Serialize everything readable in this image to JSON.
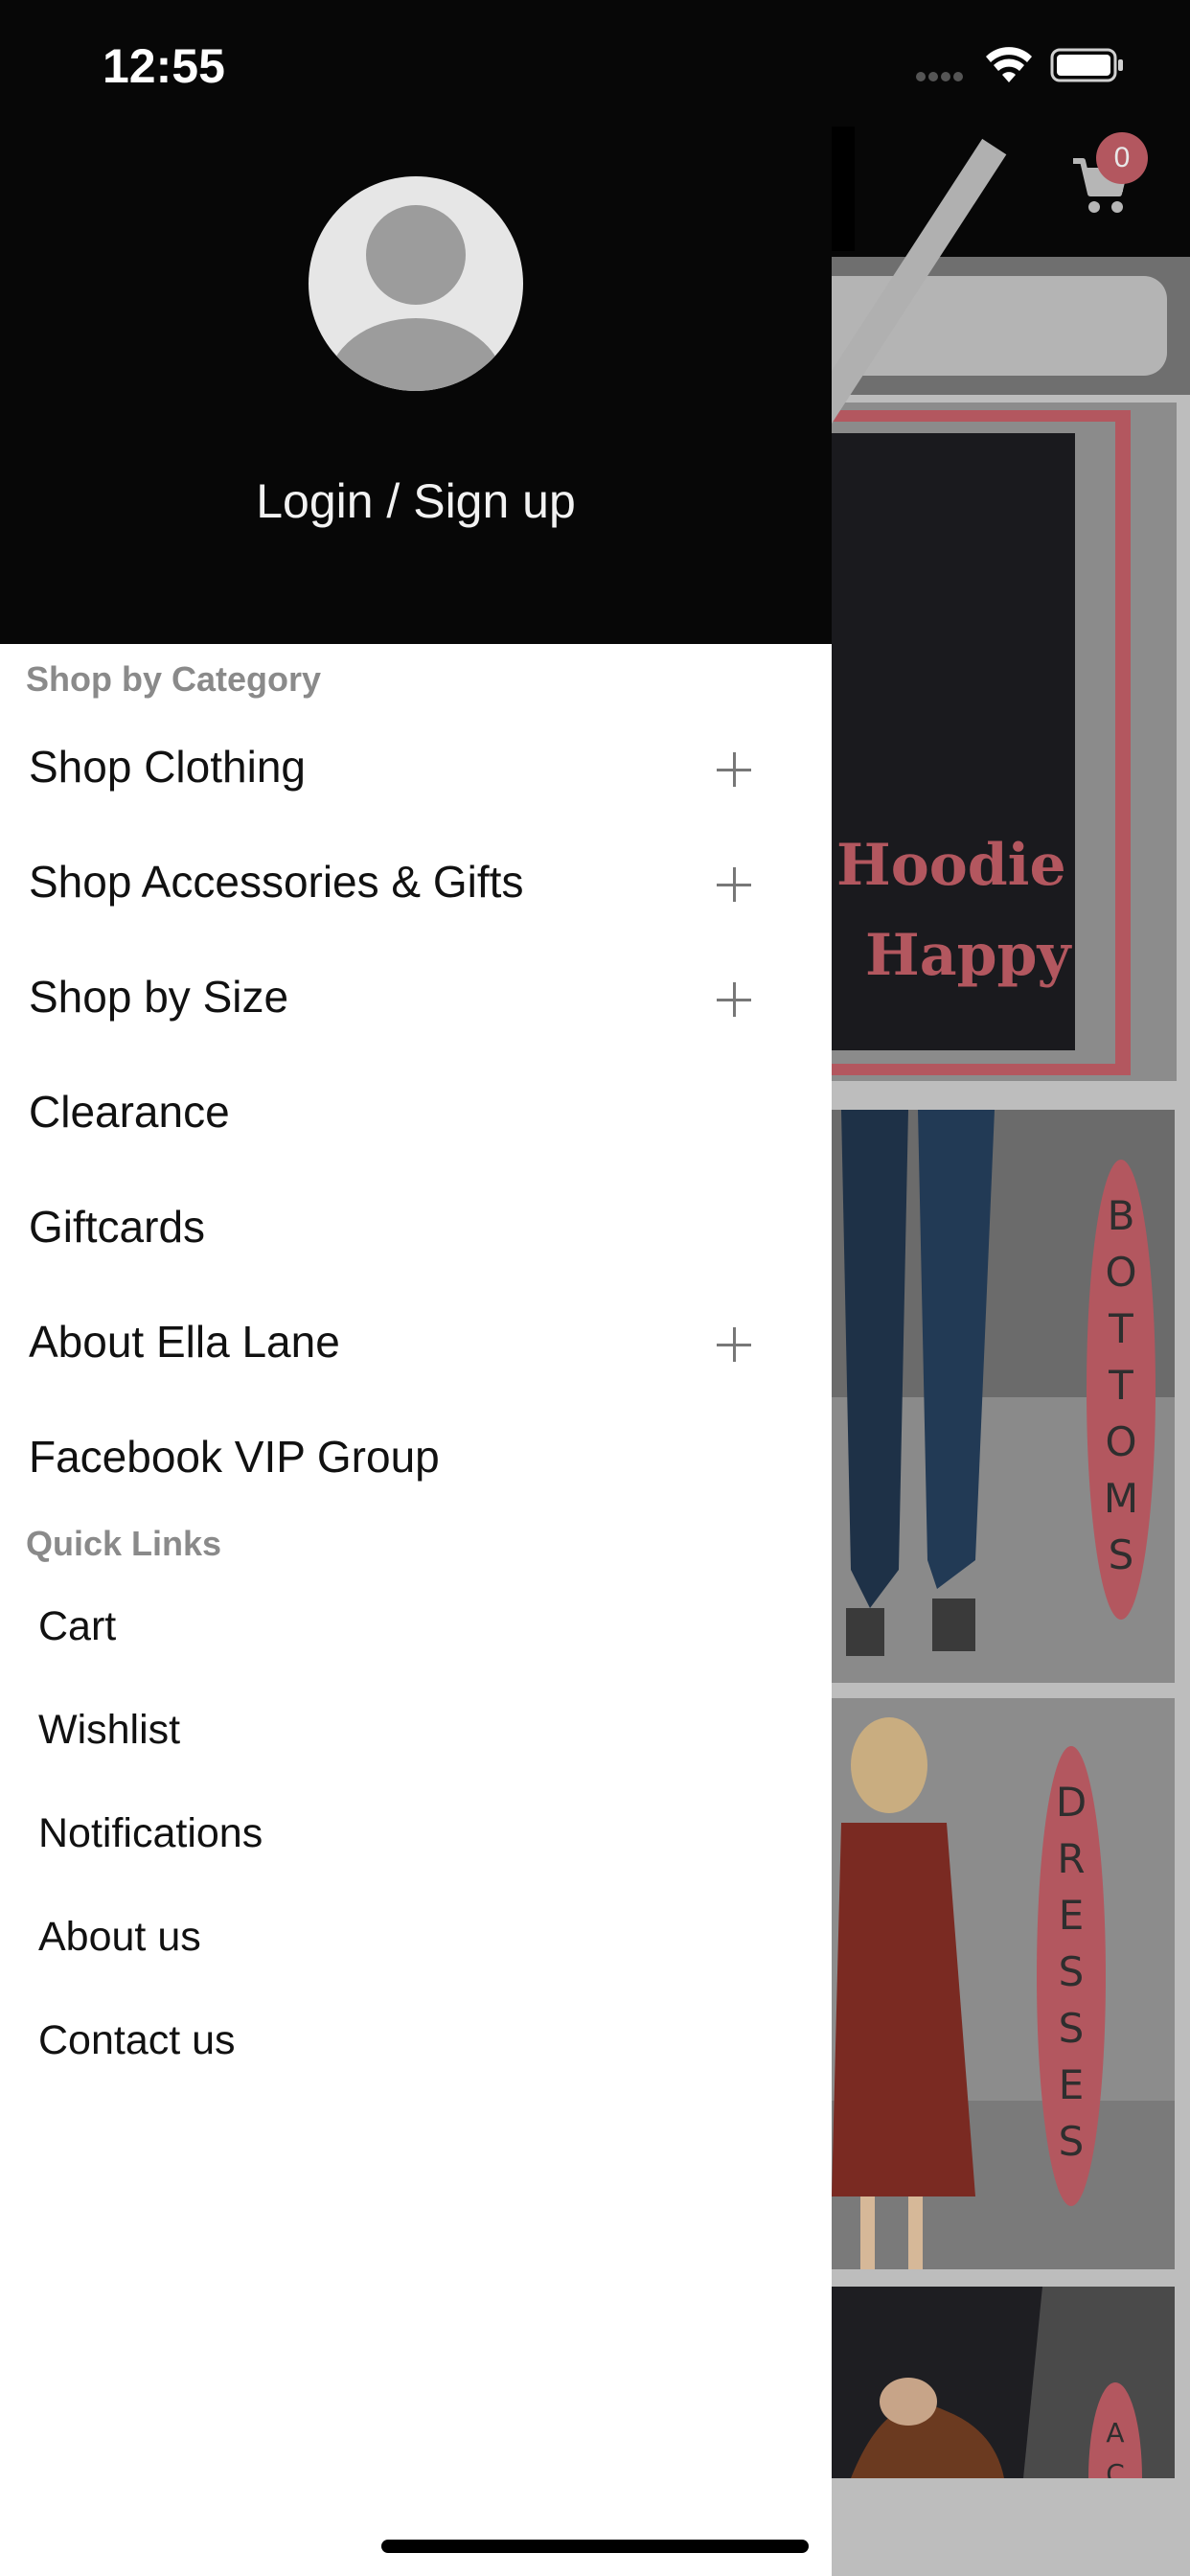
{
  "status_bar": {
    "time": "12:55"
  },
  "app": {
    "cart_count": "0",
    "banner_line_1": "Hoodie",
    "banner_line_2": "Happy",
    "tiles": {
      "bottoms": "BOTTOMS",
      "dresses": "DRESSES",
      "accessories": "ACC"
    }
  },
  "drawer": {
    "login_label": "Login / Sign up",
    "category_title": "Shop by Category",
    "categories": [
      {
        "label": "Shop Clothing",
        "expandable": true
      },
      {
        "label": "Shop Accessories & Gifts",
        "expandable": true
      },
      {
        "label": "Shop by Size",
        "expandable": true
      },
      {
        "label": "Clearance",
        "expandable": false
      },
      {
        "label": "Giftcards",
        "expandable": false
      },
      {
        "label": "About Ella Lane",
        "expandable": true
      },
      {
        "label": "Facebook VIP Group",
        "expandable": false
      }
    ],
    "quick_links_title": "Quick Links",
    "quick_links": [
      {
        "label": "Cart"
      },
      {
        "label": "Wishlist"
      },
      {
        "label": "Notifications"
      },
      {
        "label": "About us"
      },
      {
        "label": "Contact us"
      }
    ]
  },
  "colors": {
    "accent": "#b3575f",
    "header": "#070707"
  },
  "icons": {
    "avatar": "user-avatar-icon",
    "cart": "cart-icon",
    "expand": "plus-icon"
  }
}
